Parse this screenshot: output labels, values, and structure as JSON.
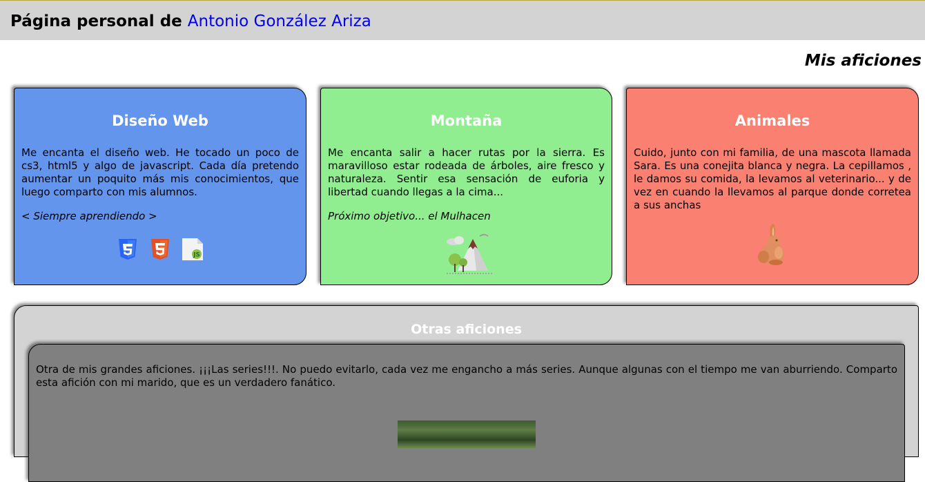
{
  "header": {
    "title_prefix": "Página personal de",
    "author_name": "Antonio González Ariza"
  },
  "section_title": "Mis aficiones",
  "cards": [
    {
      "title": "Diseño Web",
      "text": "Me encanta el diseño web. He tocado un poco de cs3, html5 y algo de javascript. Cada día pretendo aumentar un poquito más mis conocimientos, que luego comparto con mis alumnos.",
      "motto": "< Siempre aprendiendo >",
      "icons": [
        "css3-icon",
        "html5-icon",
        "javascript-file-icon"
      ],
      "color": "#6495ed"
    },
    {
      "title": "Montaña",
      "text": "Me encanta salir a hacer rutas por la sierra. Es maravilloso estar rodeada de árboles, aire fresco y naturaleza. Sentir esa sensación de euforia y libertad cuando llegas a la cima...",
      "motto": "Próximo objetivo... el Mulhacen",
      "icons": [
        "mountain-landscape-icon"
      ],
      "color": "#90ee90"
    },
    {
      "title": "Animales",
      "text": "Cuido, junto con mi familia, de una mascota llamada Sara. Es una conejita blanca y negra. La cepillamos , le damos su comida, la levamos al veterinario... y de vez en cuando la llevamos al parque donde corretea a sus anchas",
      "icons": [
        "rabbit-icon"
      ],
      "color": "#fa8072"
    }
  ],
  "other": {
    "title": "Otras aficiones",
    "text": "Otra de mis grandes aficiones. ¡¡¡Las series!!!. No puedo evitarlo, cada vez me engancho a más series. Aunque algunas con el tiempo me van aburriendo. Comparto esta afición con mi marido, que es un verdadero fanático."
  }
}
